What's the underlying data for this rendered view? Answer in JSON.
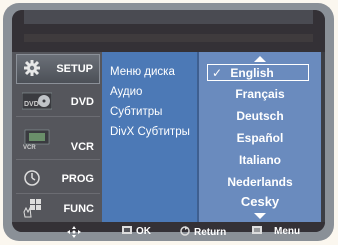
{
  "sidebar": {
    "items": [
      {
        "label": "SETUP",
        "icon": "gear-icon",
        "active": true
      },
      {
        "label": "DVD",
        "icon": "dvd-icon",
        "active": false
      },
      {
        "label": "VCR",
        "icon": "vcr-icon",
        "active": false
      },
      {
        "label": "PROG",
        "icon": "clock-icon",
        "active": false
      },
      {
        "label": "FUNC",
        "icon": "func-icon",
        "active": false
      }
    ]
  },
  "submenu": {
    "items": [
      "Меню диска",
      "Аудио",
      "Субтитры",
      "DivX Субтитры"
    ]
  },
  "languages": {
    "selected_mark": "✓",
    "items": [
      "English",
      "Français",
      "Deutsch",
      "Español",
      "Italiano",
      "Nederlands",
      "Cesky"
    ]
  },
  "footer": {
    "ok": "OK",
    "return": "Return",
    "menu": "Menu"
  },
  "colors": {
    "submenu_bg": "#4c79b6",
    "list_bg": "#6a8bbe",
    "sidebar_bg": "#55565c"
  }
}
